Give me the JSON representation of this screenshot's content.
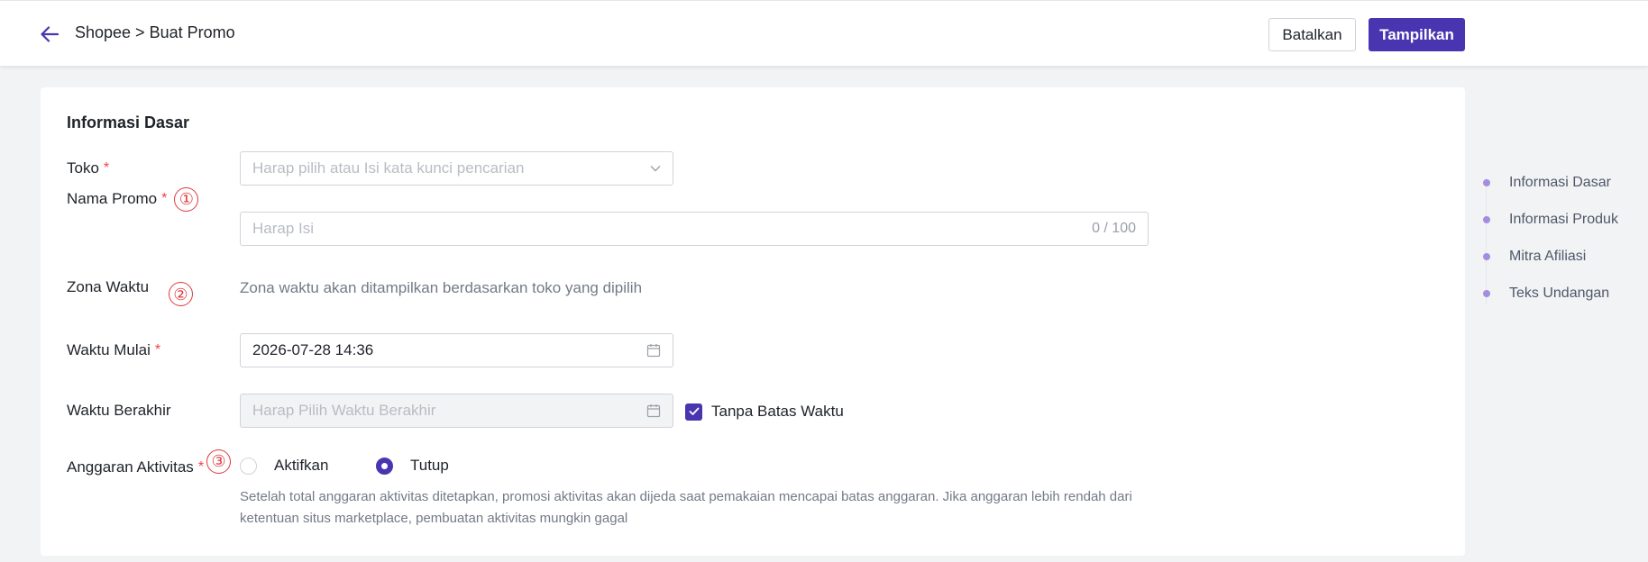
{
  "header": {
    "breadcrumb": "Shopee > Buat Promo",
    "cancel_label": "Batalkan",
    "submit_label": "Tampilkan"
  },
  "colors": {
    "primary": "#4a35b0",
    "required": "#f53f3f",
    "annotation": "#e0393e",
    "anchor_dot": "#a48de0"
  },
  "form": {
    "section_title": "Informasi Dasar",
    "toko": {
      "label": "Toko",
      "required_mark": "*",
      "placeholder": "Harap pilih atau Isi kata kunci pencarian",
      "icon": "chevron-down-icon"
    },
    "nama_promo": {
      "label": "Nama Promo",
      "required_mark": "*",
      "annotation": "①",
      "placeholder": "Harap Isi",
      "counter": "0 / 100"
    },
    "zona_waktu": {
      "label": "Zona Waktu",
      "annotation": "②",
      "helper": "Zona waktu akan ditampilkan berdasarkan toko yang dipilih"
    },
    "waktu_mulai": {
      "label": "Waktu Mulai",
      "required_mark": "*",
      "value": "2026-07-28 14:36",
      "icon": "calendar-icon"
    },
    "waktu_berakhir": {
      "label": "Waktu Berakhir",
      "placeholder": "Harap Pilih Waktu Berakhir",
      "icon": "calendar-icon",
      "checkbox_label": "Tanpa Batas Waktu",
      "checkbox_checked": true
    },
    "anggaran": {
      "label": "Anggaran Aktivitas",
      "required_mark": "*",
      "annotation": "③",
      "option_on": "Aktifkan",
      "option_off": "Tutup",
      "selected": "Tutup",
      "note": "Setelah total anggaran aktivitas ditetapkan, promosi aktivitas akan dijeda saat pemakaian mencapai batas anggaran. Jika anggaran lebih rendah dari ketentuan situs marketplace, pembuatan aktivitas mungkin gagal"
    }
  },
  "anchor_nav": {
    "items": [
      {
        "label": "Informasi Dasar"
      },
      {
        "label": "Informasi Produk"
      },
      {
        "label": "Mitra Afiliasi"
      },
      {
        "label": "Teks Undangan"
      }
    ]
  }
}
